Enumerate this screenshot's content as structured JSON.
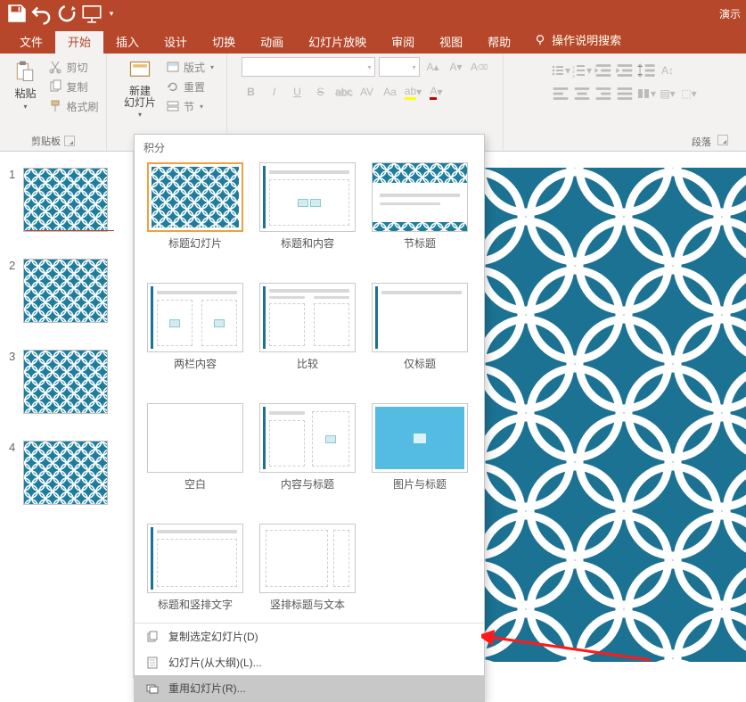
{
  "app_title": "演示",
  "qat": {
    "save": "保存",
    "undo": "撤销",
    "redo": "重做",
    "start": "从头开始"
  },
  "tabs": {
    "file": "文件",
    "home": "开始",
    "insert": "插入",
    "design": "设计",
    "transitions": "切换",
    "animations": "动画",
    "slideshow": "幻灯片放映",
    "review": "审阅",
    "view": "视图",
    "help": "帮助",
    "tellme": "操作说明搜索"
  },
  "ribbon": {
    "clipboard": {
      "label": "剪贴板",
      "paste": "粘贴",
      "cut": "剪切",
      "copy": "复制",
      "format_painter": "格式刷"
    },
    "slides": {
      "new_slide": "新建\n幻灯片",
      "layout": "版式",
      "reset": "重置",
      "section": "节"
    },
    "font": {
      "bold": "B",
      "italic": "I",
      "underline": "U",
      "strike": "S",
      "shadow": "S",
      "char_spacing": "AV",
      "case": "Aa",
      "clear_fmt": "A"
    },
    "paragraph": {
      "label": "段落"
    }
  },
  "slides_panel": {
    "items": [
      {
        "n": "1"
      },
      {
        "n": "2"
      },
      {
        "n": "3"
      },
      {
        "n": "4"
      }
    ]
  },
  "gallery": {
    "theme": "积分",
    "layouts": [
      "标题幻灯片",
      "标题和内容",
      "节标题",
      "两栏内容",
      "比较",
      "仅标题",
      "空白",
      "内容与标题",
      "图片与标题",
      "标题和竖排文字",
      "竖排标题与文本"
    ],
    "menu": {
      "duplicate": "复制选定幻灯片(D)",
      "outline": "幻灯片(从大纲)(L)...",
      "reuse": "重用幻灯片(R)..."
    }
  }
}
